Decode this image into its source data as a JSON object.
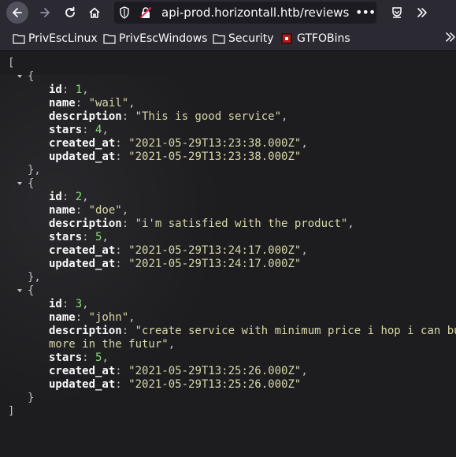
{
  "browser": {
    "url": "api-prod.horizontall.htb/reviews",
    "overflow_dots": "•••"
  },
  "bookmarks": [
    {
      "label": "PrivEscLinux",
      "icon": "folder-icon"
    },
    {
      "label": "PrivEscWindows",
      "icon": "folder-icon"
    },
    {
      "label": "Security",
      "icon": "folder-icon"
    },
    {
      "label": "GTFOBins",
      "icon": "gtfobins-favicon"
    }
  ],
  "json_view": {
    "open_bracket": "[",
    "close_bracket": "]",
    "open_brace": "{",
    "close_brace": "}",
    "close_brace_comma": "},",
    "keys": [
      "id",
      "name",
      "description",
      "stars",
      "created_at",
      "updated_at"
    ],
    "records": [
      {
        "id": "1",
        "name": "\"wail\"",
        "description": "\"This is good service\"",
        "stars": "4",
        "created_at": "\"2021-05-29T13:23:38.000Z\"",
        "updated_at": "\"2021-05-29T13:23:38.000Z\""
      },
      {
        "id": "2",
        "name": "\"doe\"",
        "description": "\"i'm satisfied with the product\"",
        "stars": "5",
        "created_at": "\"2021-05-29T13:24:17.000Z\"",
        "updated_at": "\"2021-05-29T13:24:17.000Z\""
      },
      {
        "id": "3",
        "name": "\"john\"",
        "description_line1": "\"create service with minimum price i hop i can buy",
        "description_line2": "more in the futur\"",
        "stars": "5",
        "created_at": "\"2021-05-29T13:25:26.000Z\"",
        "updated_at": "\"2021-05-29T13:25:26.000Z\""
      }
    ]
  },
  "colors": {
    "toolbar": "#2b2a33",
    "json_number": "#86de74",
    "json_string": "#d7d7a8"
  }
}
